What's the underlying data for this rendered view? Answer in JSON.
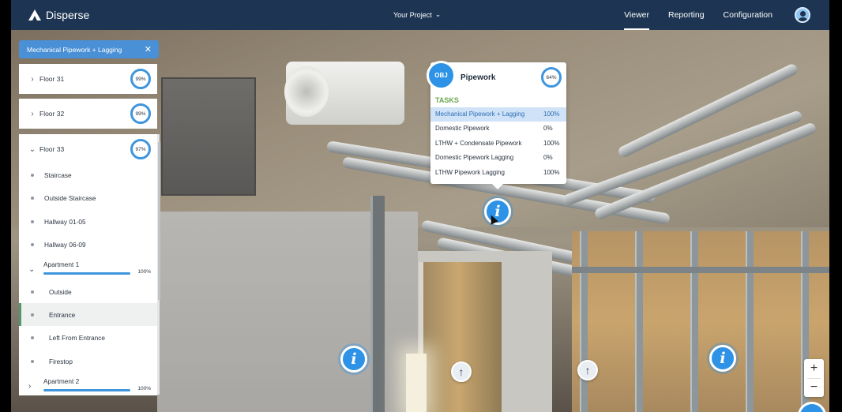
{
  "app": {
    "brand": "Disperse",
    "project_selector": "Your Project",
    "nav": [
      {
        "label": "Viewer",
        "active": true
      },
      {
        "label": "Reporting",
        "active": false
      },
      {
        "label": "Configuration",
        "active": false
      }
    ],
    "accent_color": "#2e93e6",
    "header_color": "#1d3552"
  },
  "sidebar": {
    "filter_chip": {
      "label": "Mechanical Pipework + Lagging",
      "close_icon": "close-icon"
    },
    "floors": [
      {
        "label": "Floor 31",
        "progress": "99%",
        "expanded": false
      },
      {
        "label": "Floor 32",
        "progress": "99%",
        "expanded": false
      },
      {
        "label": "Floor 33",
        "progress": "97%",
        "expanded": true
      }
    ],
    "floor33_areas": [
      {
        "label": "Staircase"
      },
      {
        "label": "Outside Staircase"
      },
      {
        "label": "Hallway 01-05"
      },
      {
        "label": "Hallway 06-09"
      }
    ],
    "apartment1": {
      "label": "Apartment 1",
      "progress": "100%",
      "progress_value": 1.0
    },
    "apartment1_areas": [
      {
        "label": "Outside"
      },
      {
        "label": "Entrance",
        "selected": true
      },
      {
        "label": "Left From Entrance"
      },
      {
        "label": "Firestop"
      }
    ],
    "apartment2": {
      "label": "Apartment 2",
      "progress": "100%",
      "progress_value": 1.0
    }
  },
  "tooltip": {
    "badge": "OBJ",
    "title": "Pipework",
    "progress": "64%",
    "tasks_heading": "TASKS",
    "tasks": [
      {
        "name": "Mechanical Pipework + Lagging",
        "percent": "100%",
        "highlighted": true
      },
      {
        "name": "Domestic Pipework",
        "percent": "0%"
      },
      {
        "name": "LTHW + Condensate Pipework",
        "percent": "100%"
      },
      {
        "name": "Domestic Pipework Lagging",
        "percent": "0%"
      },
      {
        "name": "LTHW Pipework Lagging",
        "percent": "100%"
      }
    ]
  },
  "hotspots": {
    "info_glyph": "i",
    "arrow_glyph": "↑"
  },
  "zoom": {
    "in": "+",
    "out": "−"
  }
}
